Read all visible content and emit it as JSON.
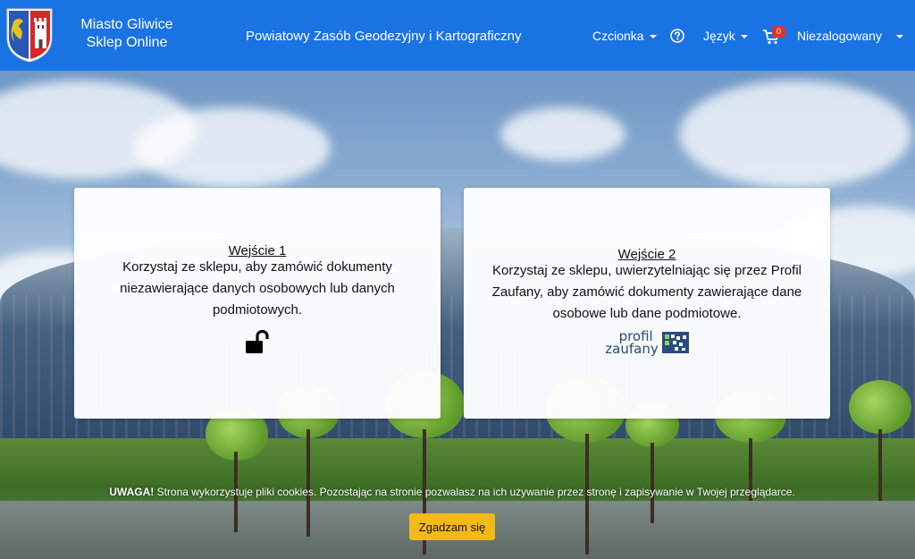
{
  "header": {
    "brand_line1": "Miasto Gliwice",
    "brand_line2": "Sklep Online",
    "center_title": "Powiatowy Zasób Geodezyjny i Kartograficzny",
    "font_menu": "Czcionka",
    "language_menu": "Język",
    "cart_count": "0",
    "user_menu": "Niezalogowany",
    "bg_color": "#1a73e3"
  },
  "cards": [
    {
      "title": "Wejście 1",
      "text": "Korzystaj ze sklepu, aby zamówić dokumenty niezawierające danych osobowych lub danych podmiotowych.",
      "icon": "unlock-icon"
    },
    {
      "title": "Wejście 2",
      "text": "Korzystaj ze sklepu, uwierzytelniając się przez Profil Zaufany, aby zamówić dokumenty zawierające dane osobowe lub dane podmiotowe.",
      "icon": "profil-zaufany-logo",
      "logo_line1": "profil",
      "logo_line2": "zaufany"
    }
  ],
  "cookie": {
    "warning_label": "UWAGA!",
    "message": " Strona wykorzystuje pliki cookies. Pozostając na stronie pozwalasz na ich używanie przez stronę i zapisywanie w Twojej przeglądarce.",
    "agree_button": "Zgadzam się",
    "button_color": "#f3b916"
  }
}
